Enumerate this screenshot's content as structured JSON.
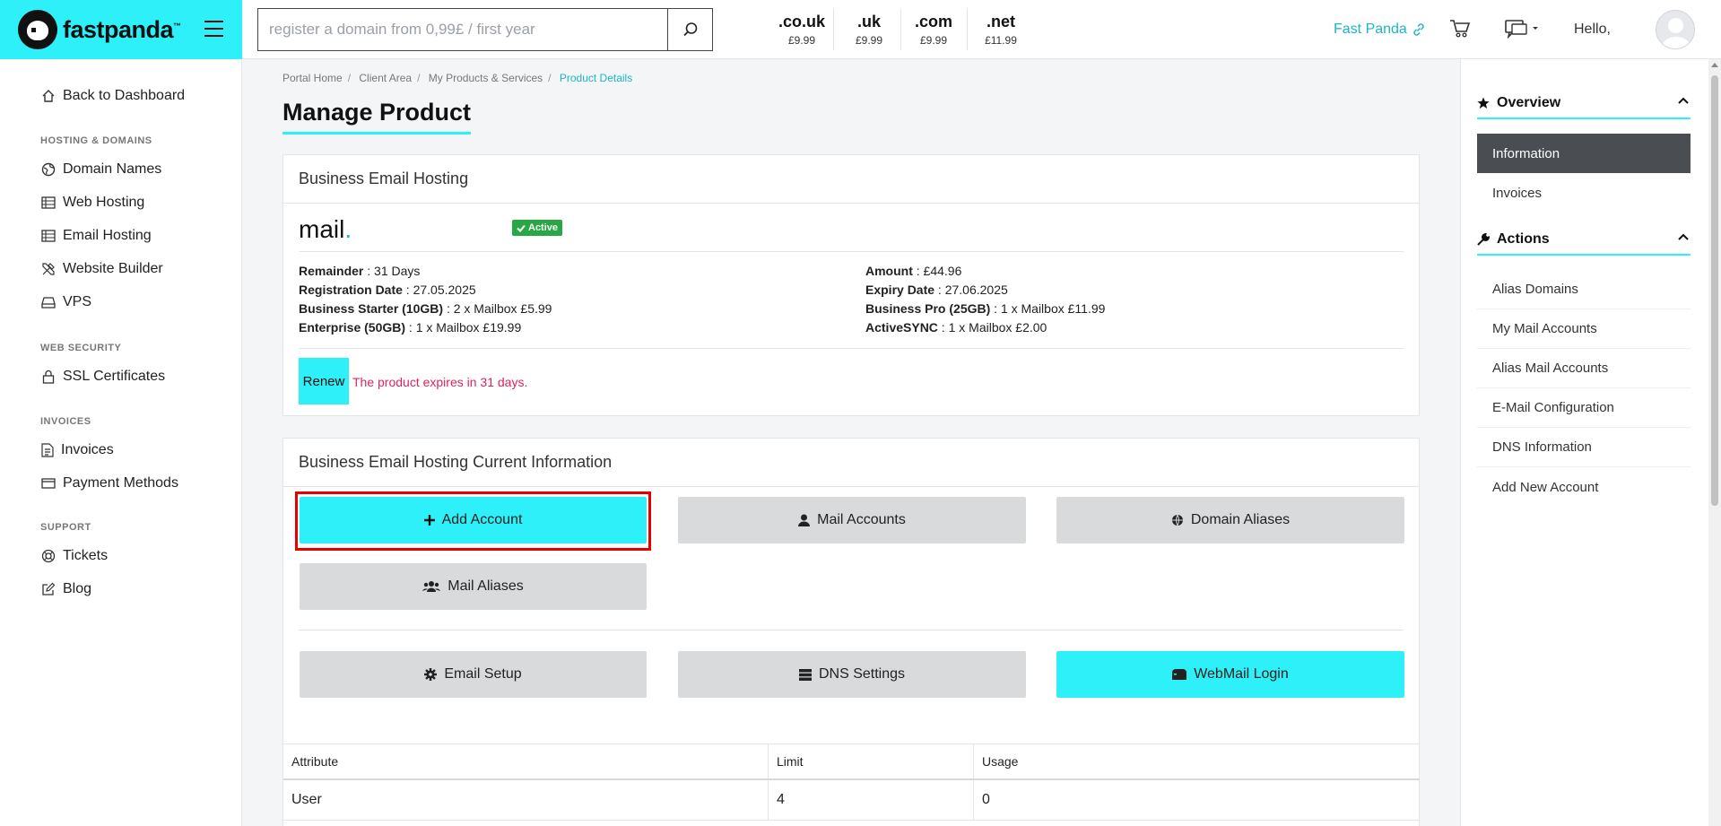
{
  "header": {
    "brand": "fastpanda",
    "brand_tm": "™",
    "search_placeholder": "register a domain from 0,99£ / first year",
    "tlds": [
      {
        "ext": ".co.uk",
        "price": "£9.99"
      },
      {
        "ext": ".uk",
        "price": "£9.99"
      },
      {
        "ext": ".com",
        "price": "£9.99"
      },
      {
        "ext": ".net",
        "price": "£11.99"
      }
    ],
    "fast_panda_link": "Fast Panda",
    "greeting": "Hello,"
  },
  "sidebar": {
    "back": "Back to Dashboard",
    "sections": [
      {
        "title": "HOSTING & DOMAINS",
        "items": [
          "Domain Names",
          "Web Hosting",
          "Email Hosting",
          "Website Builder",
          "VPS"
        ]
      },
      {
        "title": "WEB SECURITY",
        "items": [
          "SSL Certificates"
        ]
      },
      {
        "title": "INVOICES",
        "items": [
          "Invoices",
          "Payment Methods"
        ]
      },
      {
        "title": "SUPPORT",
        "items": [
          "Tickets",
          "Blog"
        ]
      }
    ]
  },
  "breadcrumb": [
    "Portal Home",
    "Client Area",
    "My Products & Services",
    "Product Details"
  ],
  "page_title": "Manage Product",
  "product": {
    "card_title": "Business Email Hosting",
    "domain": "mail",
    "domain_dot": ".",
    "status": "Active",
    "left": [
      {
        "label": "Remainder",
        "value": "31 Days"
      },
      {
        "label": "Registration Date",
        "value": "27.05.2025"
      },
      {
        "label": "Business Starter (10GB)",
        "value": "2 x Mailbox £5.99"
      },
      {
        "label": "Enterprise (50GB)",
        "value": "1 x Mailbox £19.99"
      }
    ],
    "right": [
      {
        "label": "Amount",
        "value": "£44.96"
      },
      {
        "label": "Expiry Date",
        "value": "27.06.2025"
      },
      {
        "label": "Business Pro (25GB)",
        "value": "1 x Mailbox £11.99"
      },
      {
        "label": "ActiveSYNC",
        "value": "1 x Mailbox £2.00"
      }
    ],
    "renew_label": "Renew",
    "expire_message": "The product expires in 31 days."
  },
  "current_info": {
    "card_title": "Business Email Hosting Current Information",
    "buttons": {
      "add_account": "Add Account",
      "mail_accounts": "Mail Accounts",
      "domain_aliases": "Domain Aliases",
      "mail_aliases": "Mail Aliases",
      "email_setup": "Email Setup",
      "dns_settings": "DNS Settings",
      "webmail_login": "WebMail Login"
    },
    "table": {
      "headers": [
        "Attribute",
        "Limit",
        "Usage"
      ],
      "rows": [
        [
          "User",
          "4",
          "0"
        ]
      ]
    }
  },
  "right_sidebar": {
    "overview_title": "Overview",
    "overview_items": [
      "Information",
      "Invoices"
    ],
    "actions_title": "Actions",
    "actions_items": [
      "Alias Domains",
      "My Mail Accounts",
      "Alias Mail Accounts",
      "E-Mail Configuration",
      "DNS Information",
      "Add New Account"
    ]
  },
  "colors": {
    "accent": "#2ef0f8",
    "link": "#19b6c9",
    "active_badge": "#28a745",
    "danger_text": "#e0245e",
    "highlight_box": "#e60000"
  }
}
